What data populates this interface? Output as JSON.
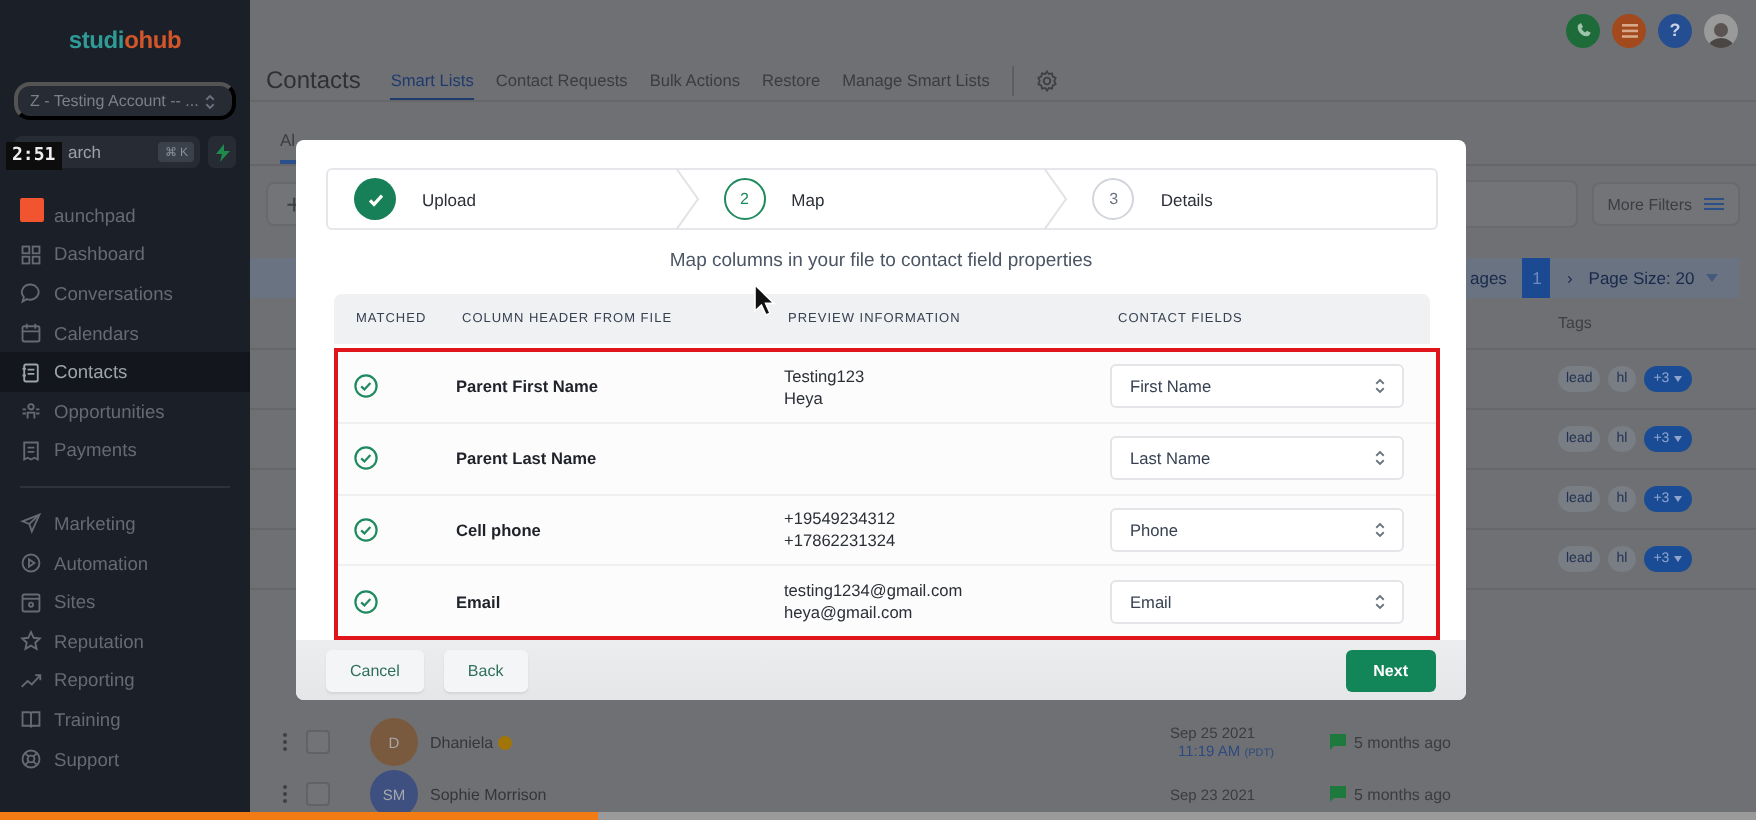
{
  "video": {
    "time": "2:51",
    "level": 0.34
  },
  "sidebar": {
    "logo": [
      {
        "text": "studi",
        "color": "#2f9a96"
      },
      {
        "text": "ohub",
        "color": "#d3562a"
      }
    ],
    "account": "Z - Testing Account -- ...",
    "search": {
      "placeholder": "arch",
      "shortcut": "⌘ K"
    },
    "groups": [
      {
        "items": [
          {
            "label": "aunchpad",
            "kind": "plain",
            "selected": false
          },
          {
            "label": "Dashboard",
            "kind": "grid",
            "selected": false
          },
          {
            "label": "Conversations",
            "kind": "chat",
            "selected": false
          },
          {
            "label": "Calendars",
            "kind": "calendar",
            "selected": false
          },
          {
            "label": "Contacts",
            "kind": "card",
            "selected": true
          },
          {
            "label": "Opportunities",
            "kind": "people",
            "selected": false
          },
          {
            "label": "Payments",
            "kind": "receipt",
            "selected": false
          }
        ]
      },
      {
        "items": [
          {
            "label": "Marketing",
            "kind": "send",
            "selected": false
          },
          {
            "label": "Automation",
            "kind": "play",
            "selected": false
          },
          {
            "label": "Sites",
            "kind": "window",
            "selected": false
          },
          {
            "label": "Reputation",
            "kind": "star",
            "selected": false
          },
          {
            "label": "Reporting",
            "kind": "trend",
            "selected": false
          },
          {
            "label": "Training",
            "kind": "book",
            "selected": false
          },
          {
            "label": "Support",
            "kind": "lifebuoy",
            "selected": false
          }
        ]
      }
    ]
  },
  "header": {
    "title": "Contacts",
    "help": "?",
    "tabs": [
      {
        "label": "Smart Lists",
        "selected": true
      },
      {
        "label": "Contact Requests",
        "selected": false
      },
      {
        "label": "Bulk Actions",
        "selected": false
      },
      {
        "label": "Restore",
        "selected": false
      },
      {
        "label": "Manage Smart Lists",
        "selected": false
      }
    ]
  },
  "background": {
    "tab": "Al",
    "add": "+",
    "more_filters": "More Filters",
    "pagination": {
      "cut_label": "ages",
      "page": "1",
      "next": "›",
      "page_size": "Page Size: 20"
    },
    "tags_heading": "Tags",
    "tag_rows": [
      {
        "tags": [
          "lead",
          "hl"
        ],
        "more": "+3"
      },
      {
        "tags": [
          "lead",
          "hl"
        ],
        "more": "+3"
      },
      {
        "tags": [
          "lead",
          "hl"
        ],
        "more": "+3"
      },
      {
        "tags": [
          "lead",
          "hl"
        ],
        "more": "+3"
      }
    ],
    "contacts": [
      {
        "checked": false,
        "initials": "D",
        "color": "#7a5a3e",
        "name": "Dhaniela",
        "badge": true,
        "date": "Sep 25 2021",
        "time": "11:19 AM",
        "zone": "(PDT)",
        "activity": "5 months ago"
      },
      {
        "checked": false,
        "initials": "SM",
        "color": "#3d5080",
        "name": "Sophie Morrison",
        "badge": false,
        "date": "Sep 23 2021",
        "activity": "5 months ago"
      }
    ]
  },
  "modal": {
    "steps": [
      {
        "label": "Upload",
        "kind": "done"
      },
      {
        "number": "2",
        "label": "Map",
        "kind": "current"
      },
      {
        "number": "3",
        "label": "Details",
        "kind": "pending"
      }
    ],
    "subtitle": "Map columns in your file to contact field properties",
    "columns": [
      "MATCHED",
      "COLUMN HEADER FROM FILE",
      "PREVIEW INFORMATION",
      "CONTACT FIELDS"
    ],
    "rows": [
      {
        "matched": true,
        "header": "Parent First Name",
        "preview": [
          "Testing123",
          "Heya"
        ],
        "field": "First Name"
      },
      {
        "matched": true,
        "header": "Parent Last Name",
        "field": "Last Name"
      },
      {
        "matched": true,
        "header": "Cell phone",
        "preview": [
          "+19549234312",
          "+17862231324"
        ],
        "field": "Phone"
      },
      {
        "matched": true,
        "header": "Email",
        "preview": [
          "testing1234@gmail.com",
          "heya@gmail.com"
        ],
        "field": "Email"
      }
    ],
    "buttons": [
      {
        "label": "Cancel",
        "kind": "secondary"
      },
      {
        "label": "Back",
        "kind": "secondary"
      },
      {
        "label": "Next",
        "kind": "primary"
      }
    ]
  }
}
